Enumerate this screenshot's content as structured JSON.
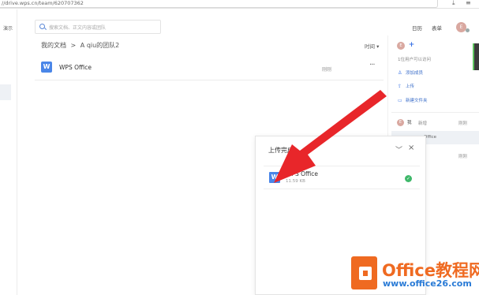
{
  "browser": {
    "url": "//drive.wps.cn/team/620707362",
    "download_icon": "download-icon",
    "menu_icon": "hamburger-menu-icon"
  },
  "left_sidebar": {
    "label": "演示"
  },
  "search": {
    "placeholder": "搜索文档、正文内容或团队"
  },
  "breadcrumb": {
    "root": "我的文档",
    "sep": ">",
    "current": "A qiu的团队2"
  },
  "sort": {
    "label": "时间",
    "arrow": "▾"
  },
  "files": [
    {
      "icon": "W",
      "name": "WPS Office",
      "time": "刚刚",
      "more": "···"
    }
  ],
  "top_right": {
    "calendar": "日历",
    "forms": "表单",
    "avatar": "E"
  },
  "right_panel": {
    "avatar": "E",
    "plus": "+",
    "members_count": "1位用户可以访问",
    "actions": [
      {
        "icon": "person-add-icon",
        "glyph": "♙",
        "label": "添加成员"
      },
      {
        "icon": "upload-icon",
        "glyph": "⇪",
        "label": "上传"
      },
      {
        "icon": "new-folder-icon",
        "glyph": "▭",
        "label": "新建文件夹"
      }
    ],
    "activity": {
      "user": "我",
      "op": "新增",
      "time": "刚刚",
      "file": "Office",
      "time2": "刚刚"
    }
  },
  "upload_panel": {
    "title": "上传完成",
    "minimize": "﹀",
    "close": "×",
    "file": {
      "icon": "W",
      "name": "WPS Office",
      "size": "11.59 KB",
      "status": "✓"
    }
  },
  "watermark": {
    "title": "Office教程网",
    "url": "www.office26.com"
  },
  "colors": {
    "accent": "#4a86e8",
    "arrow": "#e8262a",
    "watermark_orange": "#ef6a21",
    "watermark_blue": "#2a7bd6"
  }
}
